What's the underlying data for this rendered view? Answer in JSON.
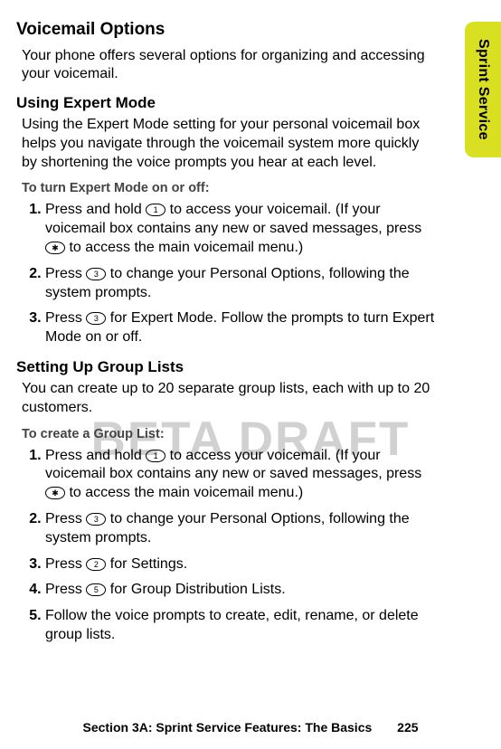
{
  "tab_label": "Sprint Service",
  "watermark": "BETA DRAFT",
  "heading": "Voicemail Options",
  "lead": "Your phone offers several options for organizing and accessing your voicemail.",
  "expert": {
    "heading": "Using Expert Mode",
    "body": "Using the Expert Mode setting for your personal voicemail box helps you navigate through the voicemail system more quickly by shortening the voice prompts you hear at each level.",
    "instr_head": "To turn Expert Mode on or off:",
    "step1_a": "Press and hold ",
    "step1_b": " to access your voicemail. (If your voicemail box contains any new or saved messages, press ",
    "step1_c": " to access the main voicemail menu.)",
    "step2_a": "Press ",
    "step2_b": " to change your Personal Options, following the system prompts.",
    "step3_a": "Press ",
    "step3_b": " for Expert Mode. Follow the prompts to turn Expert Mode on or off."
  },
  "groups": {
    "heading": "Setting Up Group Lists",
    "body": "You can create up to 20 separate group lists, each with up to 20 customers.",
    "instr_head": "To create a Group List:",
    "step1_a": "Press and hold ",
    "step1_b": " to access your voicemail. (If your voicemail box contains any new or saved messages, press ",
    "step1_c": " to access the main voicemail menu.)",
    "step2_a": "Press ",
    "step2_b": " to change your Personal Options, following the system prompts.",
    "step3_a": "Press ",
    "step3_b": " for Settings.",
    "step4_a": "Press ",
    "step4_b": " for Group Distribution Lists.",
    "step5": "Follow the voice prompts to create, edit, rename, or delete group lists."
  },
  "keys": {
    "one": "1",
    "star": "✱",
    "three": "3",
    "two": "2",
    "five": "5"
  },
  "footer": {
    "section": "Section 3A: Sprint Service Features: The Basics",
    "page": "225"
  }
}
